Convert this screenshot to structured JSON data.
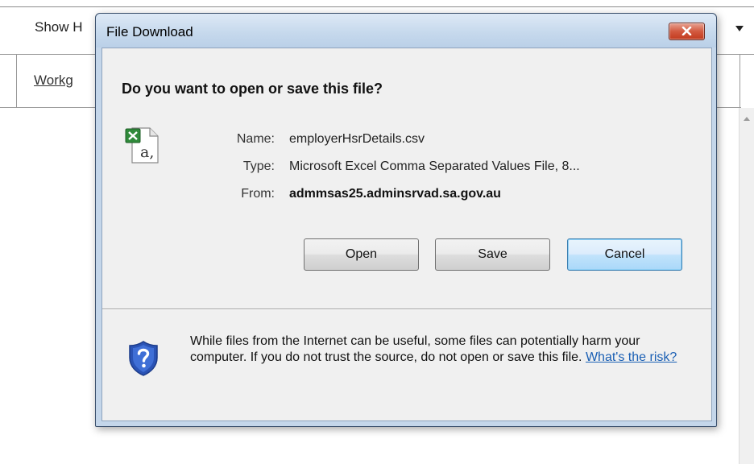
{
  "background": {
    "show_label": "Show H",
    "work_link": "Workg"
  },
  "dialog": {
    "title": "File Download",
    "heading": "Do you want to open or save this file?",
    "fields": {
      "name_label": "Name:",
      "name_value": "employerHsrDetails.csv",
      "type_label": "Type:",
      "type_value": "Microsoft Excel Comma Separated Values File, 8...",
      "from_label": "From:",
      "from_value": "admmsas25.adminsrvad.sa.gov.au"
    },
    "buttons": {
      "open": "Open",
      "save": "Save",
      "cancel": "Cancel"
    },
    "warning_text": "While files from the Internet can be useful, some files can potentially harm your computer. If you do not trust the source, do not open or save this file.",
    "risk_link": "What's the risk?"
  },
  "icons": {
    "file": "excel-csv-file-icon",
    "shield": "security-shield-question-icon",
    "close": "close-icon",
    "dropdown": "dropdown-arrow-icon"
  },
  "colors": {
    "close_button": "#c23a1d",
    "default_button_border": "#3c7fb1",
    "link": "#1a5fb4",
    "shield_blue": "#2a53b5"
  }
}
